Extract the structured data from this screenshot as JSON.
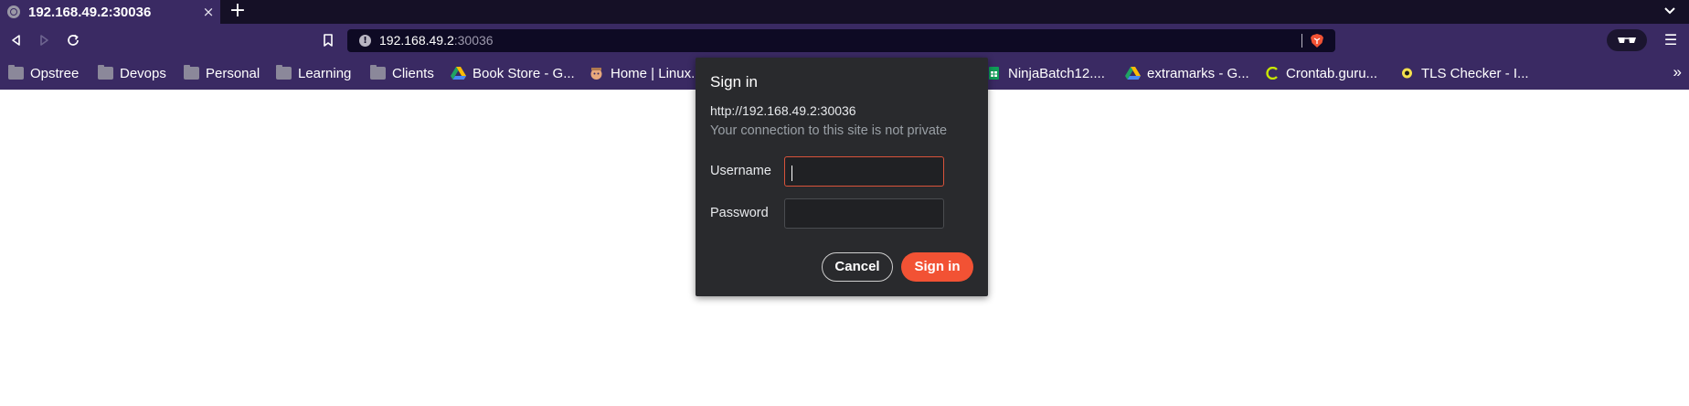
{
  "tab": {
    "title": "192.168.49.2:30036",
    "close_label": "×",
    "new_tab_label": "+"
  },
  "toolbar": {
    "url_host": "192.168.49.2",
    "url_port": ":30036",
    "info_glyph": "!",
    "menu_label": "☰"
  },
  "bookmarks": {
    "items": [
      {
        "label": "Opstree",
        "icon": "folder-icon"
      },
      {
        "label": "Devops",
        "icon": "folder-icon"
      },
      {
        "label": "Personal",
        "icon": "folder-icon"
      },
      {
        "label": "Learning",
        "icon": "folder-icon"
      },
      {
        "label": "Clients",
        "icon": "folder-icon"
      },
      {
        "label": "Book Store - G...",
        "icon": "google-drive-icon"
      },
      {
        "label": "Home | Linux...",
        "icon": "site-icon"
      },
      {
        "label": "NinjaBatch12....",
        "icon": "google-sheets-icon"
      },
      {
        "label": "extramarks - G...",
        "icon": "google-drive-icon"
      },
      {
        "label": "Crontab.guru...",
        "icon": "crontab-icon"
      },
      {
        "label": "TLS Checker - I...",
        "icon": "tls-icon"
      }
    ],
    "more_label": "»"
  },
  "dialog": {
    "title": "Sign in",
    "url": "http://192.168.49.2:30036",
    "warning": "Your connection to this site is not private",
    "username_label": "Username",
    "username_value": "",
    "password_label": "Password",
    "password_value": "",
    "cancel_label": "Cancel",
    "signin_label": "Sign in"
  },
  "colors": {
    "toolbar_bg": "#3a2a63",
    "tabstrip_bg": "#151026",
    "urlbar_bg": "#0e0a24",
    "dialog_bg": "#292a2d",
    "accent": "#f25234",
    "focus_border": "#d9533a"
  }
}
